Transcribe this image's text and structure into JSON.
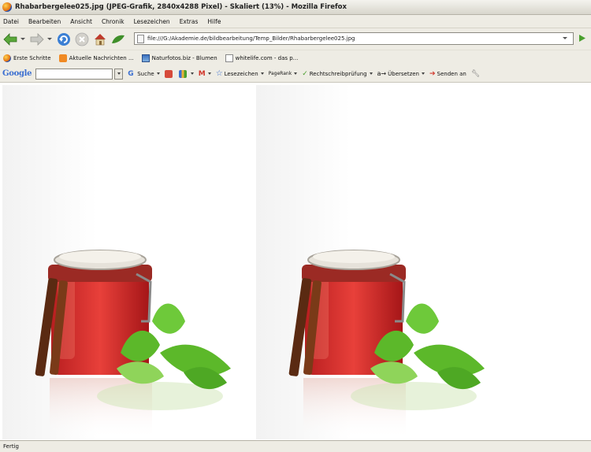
{
  "window": {
    "title": "Rhabarbergelee025.jpg (JPEG-Grafik, 2840x4288 Pixel) - Skaliert (13%) - Mozilla Firefox"
  },
  "menu": [
    "Datei",
    "Bearbeiten",
    "Ansicht",
    "Chronik",
    "Lesezeichen",
    "Extras",
    "Hilfe"
  ],
  "nav": {
    "url": "file:///G:/Akademie.de/bildbearbeitung/Temp_Bilder/Rhabarbergelee025.jpg"
  },
  "bookmarks": [
    {
      "label": "Erste Schritte",
      "icon": "firefox-icon"
    },
    {
      "label": "Aktuelle Nachrichten ...",
      "icon": "rss-icon"
    },
    {
      "label": "Naturfotos.biz - Blumen",
      "icon": "photo-icon"
    },
    {
      "label": "whitelife.com - das p...",
      "icon": "page-icon"
    }
  ],
  "google_toolbar": {
    "logo": "Google",
    "search_label": "Suche",
    "bookmarks_label": "Lesezeichen",
    "pagerank_label": "PageRank",
    "spellcheck_label": "Rechtschreibprüfung",
    "translate_label": "Übersetzen",
    "send_label": "Senden an"
  },
  "status": {
    "text": "Fertig"
  },
  "colors": {
    "chrome": "#eeece4",
    "jar_red": "#d8282a",
    "mint_green": "#5cb82a"
  }
}
